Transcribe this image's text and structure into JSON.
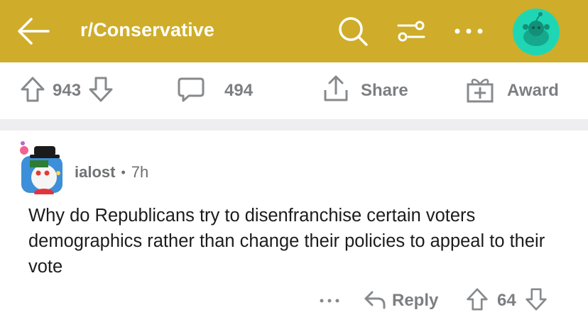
{
  "header": {
    "subreddit": "r/Conservative",
    "icons": [
      "back-arrow-icon",
      "search-icon",
      "filter-icon",
      "more-icon",
      "user-avatar"
    ],
    "bar_color": "#cfad2a"
  },
  "post_actions": {
    "upvotes": "943",
    "comments": "494",
    "share_label": "Share",
    "award_label": "Award"
  },
  "comment": {
    "username": "ialost",
    "separator": "•",
    "time": "7h",
    "body": "Why do Republicans try to disenfranchise certain voters demographics rather than change their policies to appeal to their vote",
    "reply_label": "Reply",
    "score": "64"
  }
}
